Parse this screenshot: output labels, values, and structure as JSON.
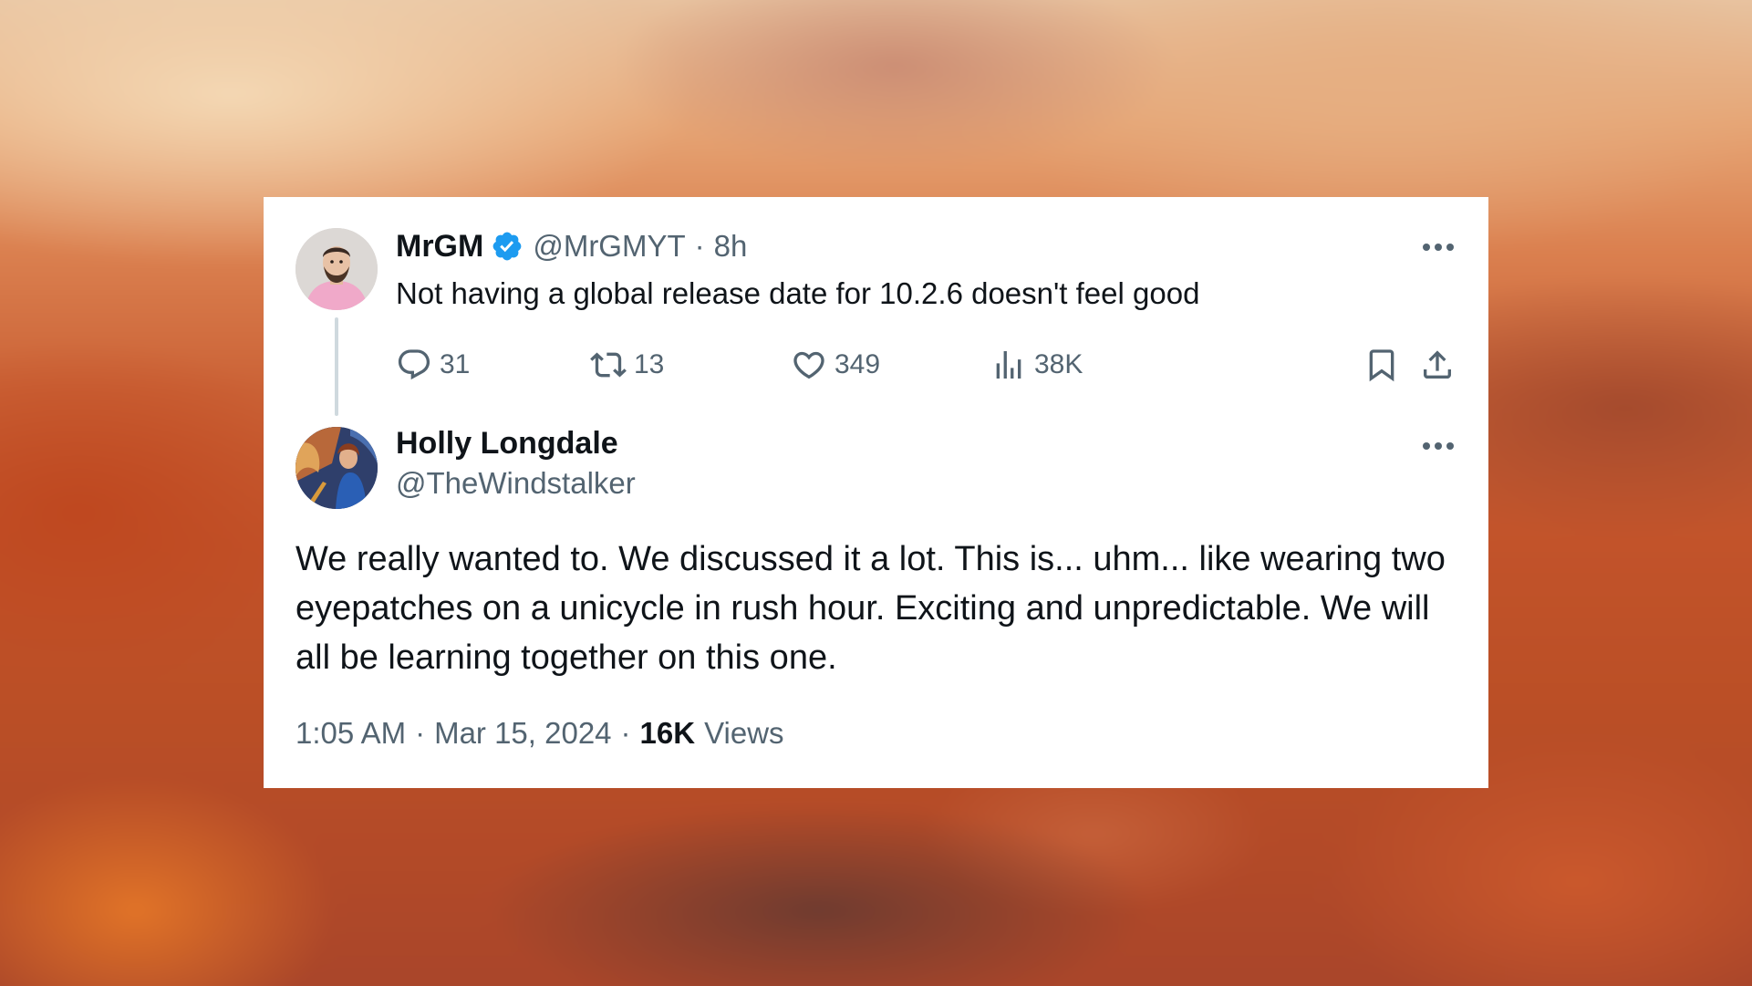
{
  "tweet_parent": {
    "display_name": "MrGM",
    "handle": "@MrGMYT",
    "separator": "·",
    "time_ago": "8h",
    "text": "Not having a global release date for 10.2.6 doesn't feel good",
    "verified_icon": "verified-badge-icon",
    "stats": {
      "replies": "31",
      "reposts": "13",
      "likes": "349",
      "views": "38K"
    }
  },
  "tweet_reply": {
    "display_name": "Holly Longdale",
    "handle": "@TheWindstalker",
    "text": "We really wanted to. We discussed it a lot. This is... uhm... like wearing two eyepatches on a unicycle in rush hour. Exciting and unpredictable. We will all be learning together on this one.",
    "time": "1:05 AM",
    "separator": "·",
    "date": "Mar 15, 2024",
    "views_count": "16K",
    "views_label": "Views"
  },
  "icons": {
    "reply": "reply-icon",
    "repost": "repost-icon",
    "like": "heart-icon",
    "views": "views-chart-icon",
    "bookmark": "bookmark-icon",
    "share": "share-icon",
    "more": "more-icon"
  },
  "colors": {
    "verified_blue": "#1d9bf0",
    "text_primary": "#0f1419",
    "text_secondary": "#536471",
    "card_background": "#ffffff"
  }
}
